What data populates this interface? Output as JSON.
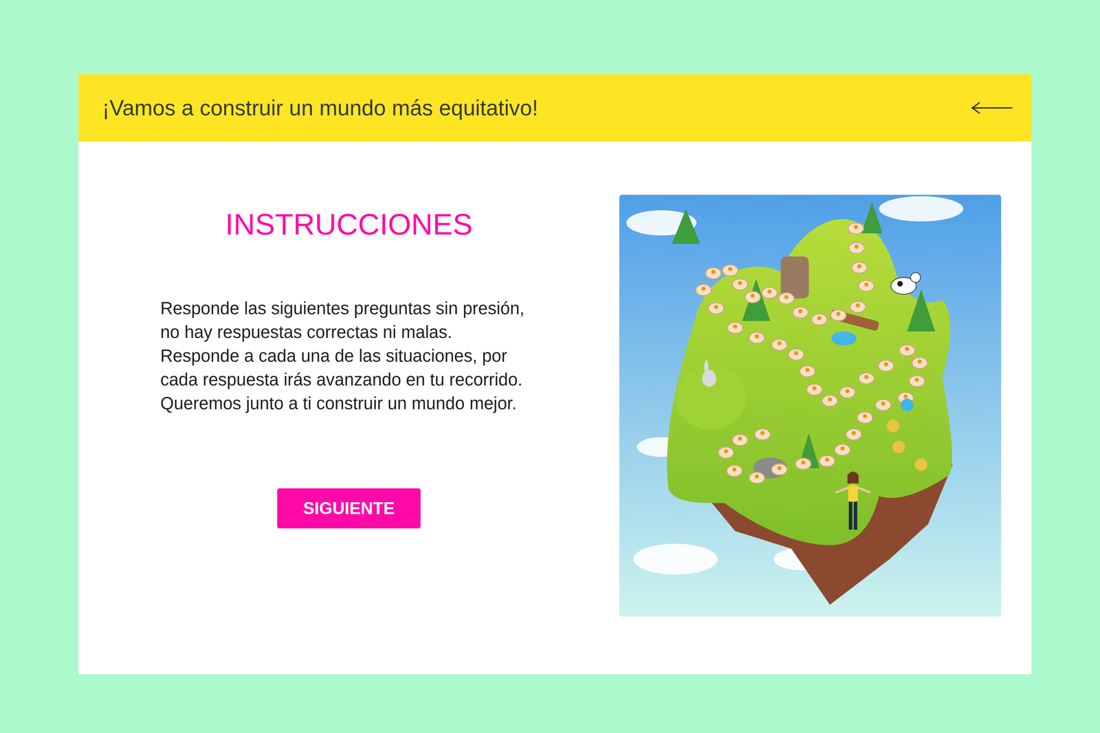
{
  "header": {
    "title": "¡Vamos a construir un mundo más equitativo!"
  },
  "instructions": {
    "title": "INSTRUCCIONES",
    "paragraphs": [
      "Responde las siguientes preguntas sin presión, no hay respuestas correctas ni malas.",
      "Responde a cada una de las situaciones, por cada respuesta irás avanzando en tu recorrido.",
      "Queremos junto a ti construir un mundo mejor."
    ]
  },
  "buttons": [
    "SIGUIENTE"
  ]
}
